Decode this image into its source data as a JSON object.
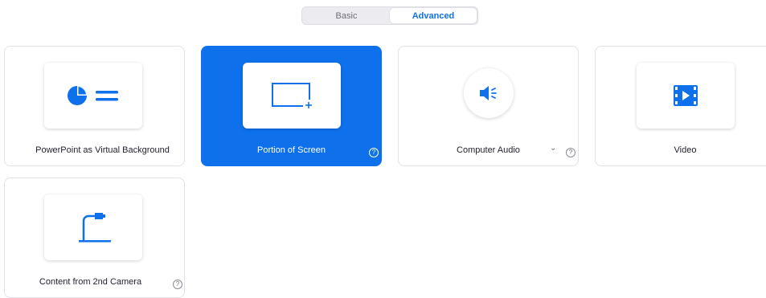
{
  "tabs": {
    "basic": "Basic",
    "advanced": "Advanced",
    "active": "advanced"
  },
  "options": {
    "powerpoint": {
      "label": "PowerPoint as Virtual Background",
      "icon": "pie-chart-lines-icon"
    },
    "portion": {
      "label": "Portion of Screen",
      "icon": "screen-region-icon",
      "selected": true
    },
    "audio": {
      "label": "Computer Audio",
      "icon": "speaker-icon"
    },
    "video": {
      "label": "Video",
      "icon": "film-play-icon"
    },
    "camera": {
      "label": "Content from 2nd Camera",
      "icon": "document-camera-icon"
    }
  },
  "help_glyph": "?",
  "dropdown_glyph": "⌄",
  "colors": {
    "accent": "#0e71eb",
    "text": "#232333",
    "border": "#e2e2e8"
  }
}
